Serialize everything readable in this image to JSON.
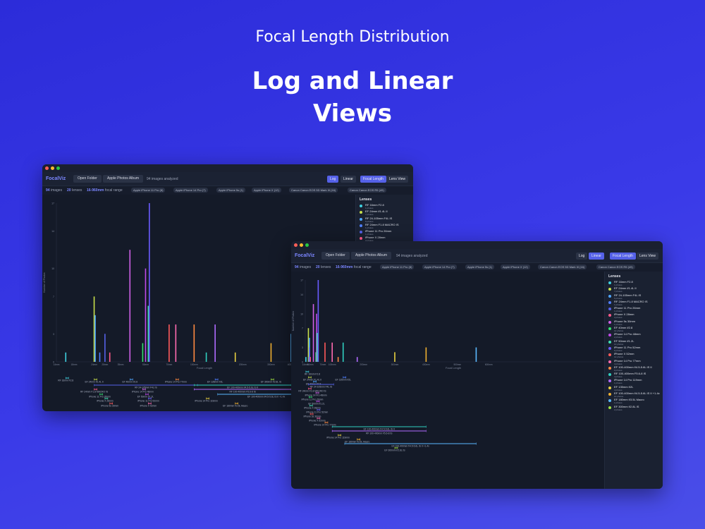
{
  "hero": {
    "subtitle": "Focal Length Distribution",
    "title_line1": "Log and Linear",
    "title_line2": "Views"
  },
  "app": {
    "logo": "FocalViz",
    "open_folder": "Open Folder",
    "apple_photos": "Apple Photos Album",
    "images_analyzed": "94 images analyzed",
    "view_log": "Log",
    "view_linear": "Linear",
    "mode_focal": "Focal Length",
    "mode_lens": "Lens View",
    "stats": {
      "images_count": "94",
      "images_label": "images",
      "lenses_count": "20",
      "lenses_label": "lenses",
      "range_value": "16-960mm",
      "range_label": "focal range"
    },
    "cameras": [
      "Apple iPhone 11 Pro (8)",
      "Apple iPhone 14 Pro (7)",
      "Apple iPhone 5s (1)",
      "Apple iPhone X (12)",
      "Canon Canon EOS 5D Mark III (16)",
      "Canon Canon EOS R5 (49)"
    ],
    "y_axis_label": "Number of Photos",
    "x_axis_label": "Focal Length",
    "sidebar_title": "Lenses",
    "lenses": [
      {
        "name": "RF 16mm F2.8",
        "count": "1 photos",
        "color": "#3fd0e0"
      },
      {
        "name": "EF 24mm f/1.4L II",
        "count": "7 photos",
        "color": "#c8e04a"
      },
      {
        "name": "RF 24-105mm F4L IS",
        "count": "5 photos",
        "color": "#4fa6ff"
      },
      {
        "name": "RF 24mm F1.8 MACRO IS",
        "count": "1 photos",
        "color": "#4f7fff"
      },
      {
        "name": "iPhone 11 Pro 26mm",
        "count": "1 photos",
        "color": "#5561e8"
      },
      {
        "name": "iPhone X 28mm",
        "count": "3 photos",
        "color": "#ff5a8a"
      },
      {
        "name": "iPhone 5s 30mm",
        "count": "1 photos",
        "color": "#d060e8"
      },
      {
        "name": "EF 40mm f/2.8",
        "count": "12 photos",
        "color": "#35e070"
      },
      {
        "name": "iPhone 14 Pro 48mm",
        "count": "2 photos",
        "color": "#c04ae8"
      },
      {
        "name": "EF 50mm f/1.2L",
        "count": "10 photos",
        "color": "#40e0b0"
      },
      {
        "name": "iPhone 11 Pro 52mm",
        "count": "6 photos",
        "color": "#6a5cff"
      },
      {
        "name": "iPhone X 52mm",
        "count": "12 photos",
        "color": "#ff5a5a"
      },
      {
        "name": "iPhone 14 Pro 77mm",
        "count": "4 photos",
        "color": "#ff6ab0"
      },
      {
        "name": "EF 100-400mm f/4.5-5.6L IS II",
        "count": "9 photos",
        "color": "#ff8a40"
      },
      {
        "name": "RF 100-400mm F5.6-8 IS",
        "count": "4 photos",
        "color": "#30d0c0"
      },
      {
        "name": "iPhone 14 Pro 119mm",
        "count": "1 photos",
        "color": "#b06aff"
      },
      {
        "name": "EF 135mm f/2L",
        "count": "4 photos",
        "color": "#e8d040"
      },
      {
        "name": "EF 100-400mm f/4.5-5.6L IS II +1.4x",
        "count": "10 photos",
        "color": "#f0b030"
      },
      {
        "name": "EF 180mm f/3.5L Macro",
        "count": "1 photos",
        "color": "#5ab8ff"
      },
      {
        "name": "EF 300mm f/2.8L IS",
        "count": "2 photos",
        "color": "#a0e040"
      }
    ],
    "log_ticks": [
      "14mm",
      "18mm",
      "24mm",
      "28mm",
      "35mm",
      "50mm",
      "70mm",
      "100mm",
      "200mm",
      "300mm",
      "400mm",
      "600mm"
    ],
    "linear_ticks": [
      "14mm",
      "30mm",
      "70mm",
      "100mm",
      "200mm",
      "300mm",
      "400mm",
      "500mm",
      "600mm"
    ],
    "y_ticks": [
      "17",
      "14",
      "10",
      "7",
      "3",
      "0"
    ],
    "range_labels": [
      "RF 16mm F2.8",
      "EF 24mm f/1.4L II",
      "EF 40mm f/2.8",
      "EF 135mm f/2L",
      "RF 24-105mm F4L IS",
      "RF 24mm F1.8 MACRO IS",
      "iPhone 14 Pro 48mm",
      "iPhone 11 Pro 26mm",
      "EF 50mm f/1.2L",
      "iPhone X 28mm",
      "iPhone 11 Pro 52mm",
      "iPhone 5s 30mm",
      "iPhone X 52mm",
      "iPhone 14 Pro 77mm",
      "EF 100-400mm f/4.5-5.6L IS II",
      "RF 100-400mm F5.6-8 IS",
      "iPhone 14 Pro 119mm",
      "EF 180mm f/3.5L Macro",
      "EF 100-400mm f/4.5-5.6L IS II +1.4x",
      "EF 300mm f/2.8L IS"
    ]
  },
  "chart_data": [
    {
      "type": "bar",
      "title": "",
      "xlabel": "Focal Length",
      "ylabel": "Number of Photos",
      "x_scale": "log",
      "ylim": [
        0,
        17
      ],
      "x": [
        16,
        24,
        24,
        26,
        28,
        30,
        40,
        48,
        50,
        52,
        52,
        70,
        77,
        100,
        119,
        135,
        180,
        300,
        400,
        560
      ],
      "values": [
        1,
        7,
        5,
        1,
        3,
        1,
        12,
        2,
        10,
        6,
        17,
        4,
        4,
        4,
        1,
        4,
        1,
        2,
        3,
        3
      ]
    },
    {
      "type": "bar",
      "title": "",
      "xlabel": "Focal Length",
      "ylabel": "Number of Photos",
      "x_scale": "linear",
      "ylim": [
        0,
        17
      ],
      "x": [
        16,
        24,
        24,
        26,
        28,
        30,
        40,
        48,
        50,
        52,
        52,
        77,
        100,
        119,
        135,
        180,
        300,
        400,
        560
      ],
      "values": [
        1,
        7,
        5,
        1,
        3,
        1,
        12,
        2,
        10,
        6,
        17,
        4,
        4,
        1,
        4,
        1,
        2,
        3,
        3
      ]
    }
  ]
}
